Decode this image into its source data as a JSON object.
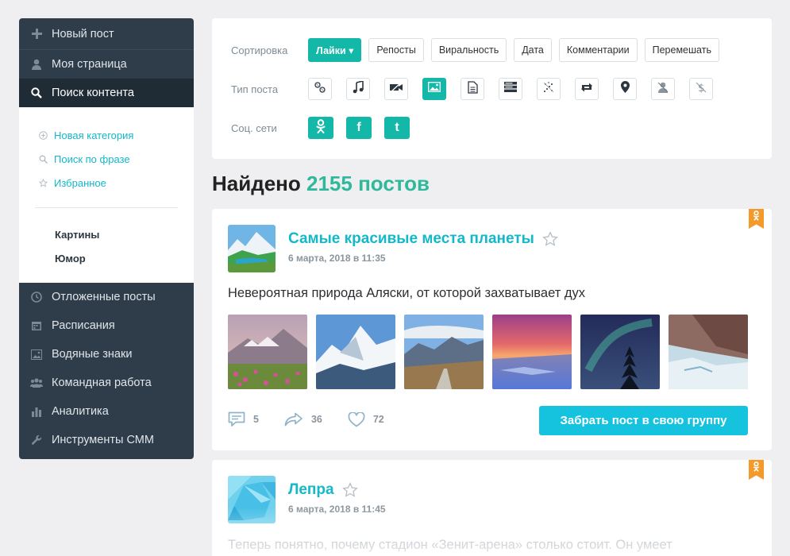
{
  "sidebar": {
    "new_post": "Новый пост",
    "my_page": "Моя страница",
    "content_search": "Поиск контента",
    "sub_links": [
      "Новая категория",
      "Поиск по фразе",
      "Избранное"
    ],
    "categories": [
      "Картины",
      "Юмор"
    ],
    "lower_items": [
      "Отложенные посты",
      "Расписания",
      "Водяные знаки",
      "Командная работа",
      "Аналитика",
      "Инструменты СММ"
    ]
  },
  "filters": {
    "sort_label": "Сортировка",
    "sort_buttons": [
      "Лайки ▾",
      "Репосты",
      "Виральность",
      "Дата",
      "Комментарии",
      "Перемешать"
    ],
    "type_label": "Тип поста",
    "social_label": "Соц. сети"
  },
  "found": {
    "prefix": "Найдено",
    "count": "2155 постов"
  },
  "post1": {
    "title": "Самые красивые места планеты",
    "date": "6 марта, 2018 в 11:35",
    "text": "Невероятная природа Аляски, от которой захватывает дух",
    "comments": "5",
    "reposts": "36",
    "likes": "72",
    "take_button": "Забрать пост в свою группу"
  },
  "post2": {
    "title": "Лепра",
    "date": "6 марта, 2018 в 11:45",
    "text": "Теперь понятно, почему стадион «Зенит-арена» столько стоит. Он умеет"
  },
  "colors": {
    "accent": "#13b8a8",
    "link": "#13b8c9",
    "sidebar": "#2f3d4a",
    "bookmark": "#f39a2b",
    "button": "#15c3df"
  }
}
